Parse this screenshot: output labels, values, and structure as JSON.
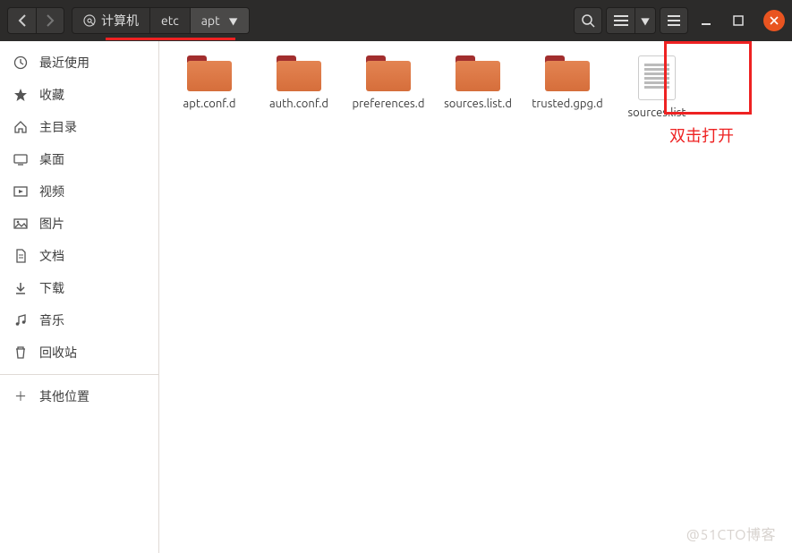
{
  "header": {
    "breadcrumbs": [
      {
        "label": "计算机",
        "icon": "disk-icon"
      },
      {
        "label": "etc"
      },
      {
        "label": "apt",
        "active": true
      }
    ]
  },
  "sidebar": {
    "primary": [
      {
        "name": "recent",
        "label": "最近使用",
        "icon": "clock-icon"
      },
      {
        "name": "starred",
        "label": "收藏",
        "icon": "star-icon"
      },
      {
        "name": "home",
        "label": "主目录",
        "icon": "home-icon"
      },
      {
        "name": "desktop",
        "label": "桌面",
        "icon": "desktop-icon"
      },
      {
        "name": "videos",
        "label": "视频",
        "icon": "video-icon"
      },
      {
        "name": "pictures",
        "label": "图片",
        "icon": "pictures-icon"
      },
      {
        "name": "documents",
        "label": "文档",
        "icon": "documents-icon"
      },
      {
        "name": "downloads",
        "label": "下载",
        "icon": "downloads-icon"
      },
      {
        "name": "music",
        "label": "音乐",
        "icon": "music-icon"
      },
      {
        "name": "trash",
        "label": "回收站",
        "icon": "trash-icon"
      }
    ],
    "other": {
      "label": "其他位置",
      "icon": "plus-icon"
    }
  },
  "content": {
    "items": [
      {
        "type": "folder",
        "label": "apt.conf.d"
      },
      {
        "type": "folder",
        "label": "auth.conf.d"
      },
      {
        "type": "folder",
        "label": "preferences.d"
      },
      {
        "type": "folder",
        "label": "sources.list.d"
      },
      {
        "type": "folder",
        "label": "trusted.gpg.d"
      },
      {
        "type": "file",
        "label": "sources.list",
        "highlighted": true
      }
    ]
  },
  "annotation": "双击打开",
  "watermark": "@51CTO博客"
}
